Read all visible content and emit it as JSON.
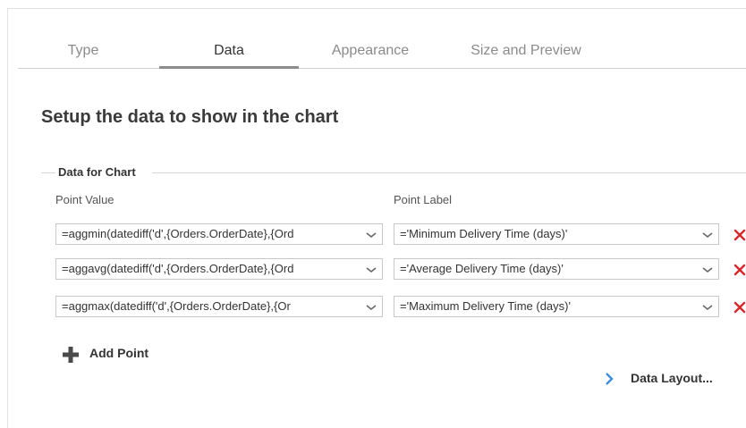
{
  "tabs": [
    {
      "label": "Type",
      "active": false
    },
    {
      "label": "Data",
      "active": true
    },
    {
      "label": "Appearance",
      "active": false
    },
    {
      "label": "Size and Preview",
      "active": false
    }
  ],
  "heading": "Setup the data to show in the chart",
  "group": {
    "legend": "Data for Chart",
    "point_value_label": "Point Value",
    "point_label_label": "Point Label"
  },
  "rows": [
    {
      "value": "=aggmin(datediff('d',{Orders.OrderDate},{Orders.ShippedDate}))",
      "value_visible": "=aggmin(datediff('d',{Orders.OrderDate},{Ord",
      "label": "='Minimum Delivery Time (days)'"
    },
    {
      "value": "=aggavg(datediff('d',{Orders.OrderDate},{Orders.ShippedDate}))",
      "value_visible": "=aggavg(datediff('d',{Orders.OrderDate},{Ord",
      "label": "='Average Delivery Time (days)'"
    },
    {
      "value": "=aggmax(datediff('d',{Orders.OrderDate},{Orders.ShippedDate}))",
      "value_visible": "=aggmax(datediff('d',{Orders.OrderDate},{Or",
      "label": "='Maximum Delivery Time (days)'"
    }
  ],
  "add_point_label": "Add Point",
  "data_layout_label": "Data Layout...",
  "icons": {
    "delete": "close-icon",
    "dropdown": "chevron-down-icon",
    "add": "plus-icon",
    "link": "chevron-right-icon"
  },
  "colors": {
    "delete": "#d9262a",
    "link_arrow": "#3d8fd6",
    "active_tab_underline": "#8c8c8c"
  }
}
